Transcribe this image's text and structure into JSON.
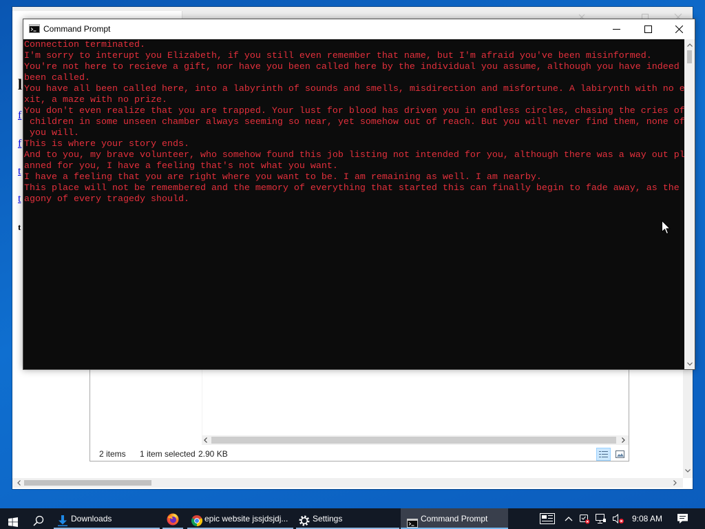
{
  "desktop": {
    "background_color": "#0b62c0"
  },
  "browser": {
    "page_fragments": [
      "l",
      "f",
      "f",
      "t",
      "t",
      "t"
    ],
    "link_color": "#0000ee"
  },
  "explorer": {
    "status": {
      "item_count": "2 items",
      "selection": "1 item selected",
      "size": "2.90 KB"
    }
  },
  "cmd": {
    "title": "Command Prompt",
    "icon": "cmd-icon",
    "text_color": "#e5303c",
    "background_color": "#0c0c0c",
    "lines": [
      "Connection terminated.",
      "I'm sorry to interupt you Elizabeth, if you still even remember that name, but I'm afraid you've been misinformed.",
      "You're not here to recieve a gift, nor have you been called here by the individual you assume, although you have indeed ",
      "been called.",
      "You have all been called here, into a labyrinth of sounds and smells, misdirection and misfortune. A labirynth with no e",
      "xit, a maze with no prize.",
      "You don't even realize that you are trapped. Your lust for blood has driven you in endless circles, chasing the cries of",
      " children in some unseen chamber always seeming so near, yet somehow out of reach. But you will never find them, none of",
      " you will.",
      "This is where your story ends.",
      "And to you, my brave volunteer, who somehow found this job listing not intended for you, although there was a way out pl",
      "anned for you, I have a feeling that's not what you want.",
      "I have a feeling that you are right where you want to be. I am remaining as well. I am nearby.",
      "This place will not be remembered and the memory of everything that started this can finally begin to fade away, as the ",
      "agony of every tragedy should."
    ]
  },
  "taskbar": {
    "apps": [
      {
        "label": "Downloads",
        "icon": "downloads-icon"
      },
      {
        "icon": "firefox-icon"
      },
      {
        "label": "epic website jssjdsjdj...",
        "icon": "chrome-icon"
      },
      {
        "label": "Settings",
        "icon": "gear-icon"
      },
      {
        "label": "Command Prompt",
        "icon": "cmd-icon",
        "active": true
      }
    ],
    "tray_icons": [
      "news-icon",
      "chevron-up-icon",
      "security-icon",
      "network-icon",
      "volume-muted-icon",
      "notification-icon"
    ],
    "clock": "9:08 AM"
  }
}
